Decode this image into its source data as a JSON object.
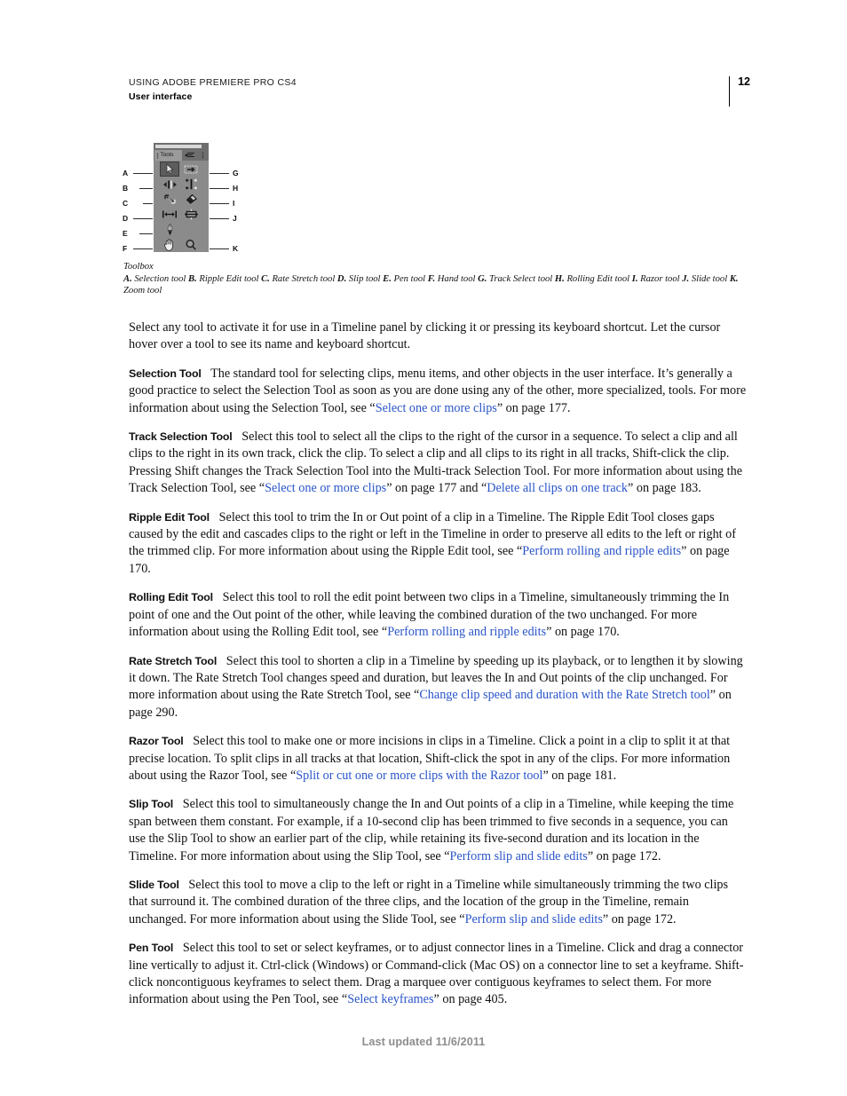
{
  "header": {
    "title": "USING ADOBE PREMIERE PRO CS4",
    "subtitle": "User interface",
    "page_number": "12"
  },
  "figure": {
    "panel": {
      "tab_label": "Tools",
      "menu_icon": "panel-menu-icon"
    },
    "tools": [
      {
        "letter": "A",
        "name": "Selection tool",
        "icon": "arrow-pointer-icon",
        "side": "left",
        "selected": true
      },
      {
        "letter": "B",
        "name": "Ripple Edit tool",
        "icon": "ripple-edit-icon",
        "side": "left",
        "selected": false
      },
      {
        "letter": "C",
        "name": "Rate Stretch tool",
        "icon": "rate-stretch-icon",
        "side": "left",
        "selected": false
      },
      {
        "letter": "D",
        "name": "Slip tool",
        "icon": "slip-tool-icon",
        "side": "left",
        "selected": false
      },
      {
        "letter": "E",
        "name": "Pen tool",
        "icon": "pen-tool-icon",
        "side": "left",
        "selected": false
      },
      {
        "letter": "F",
        "name": "Hand tool",
        "icon": "hand-tool-icon",
        "side": "left",
        "selected": false
      },
      {
        "letter": "G",
        "name": "Track Select tool",
        "icon": "track-select-icon",
        "side": "right",
        "selected": false
      },
      {
        "letter": "H",
        "name": "Rolling Edit tool",
        "icon": "rolling-edit-icon",
        "side": "right",
        "selected": false
      },
      {
        "letter": "I",
        "name": "Razor tool",
        "icon": "razor-blade-icon",
        "side": "right",
        "selected": false
      },
      {
        "letter": "J",
        "name": "Slide tool",
        "icon": "slide-tool-icon",
        "side": "right",
        "selected": false
      },
      {
        "letter": "K",
        "name": "Zoom tool",
        "icon": "magnifier-icon",
        "side": "right",
        "selected": false
      }
    ],
    "caption_title": "Toolbox",
    "caption_items": [
      {
        "letter": "A.",
        "text": "Selection tool"
      },
      {
        "letter": "B.",
        "text": "Ripple Edit tool"
      },
      {
        "letter": "C.",
        "text": "Rate Stretch tool"
      },
      {
        "letter": "D.",
        "text": "Slip tool"
      },
      {
        "letter": "E.",
        "text": "Pen tool"
      },
      {
        "letter": "F.",
        "text": "Hand tool"
      },
      {
        "letter": "G.",
        "text": "Track Select tool"
      },
      {
        "letter": "H.",
        "text": "Rolling Edit tool"
      },
      {
        "letter": "I.",
        "text": "Razor tool"
      },
      {
        "letter": "J.",
        "text": "Slide tool"
      },
      {
        "letter": "K.",
        "text": "Zoom tool"
      }
    ]
  },
  "body": {
    "intro": "Select any tool to activate it for use in a Timeline panel by clicking it or pressing its keyboard shortcut. Let the cursor hover over a tool to see its name and keyboard shortcut.",
    "sections": [
      {
        "heading": "Selection Tool",
        "parts": [
          {
            "type": "text",
            "value": "The standard tool for selecting clips, menu items, and other objects in the user interface. It’s generally a good practice to select the Selection Tool as soon as you are done using any of the other, more specialized, tools. For more information about using the Selection Tool, see “"
          },
          {
            "type": "link",
            "value": "Select one or more clips"
          },
          {
            "type": "text",
            "value": "” on page 177."
          }
        ]
      },
      {
        "heading": "Track Selection Tool",
        "parts": [
          {
            "type": "text",
            "value": "Select this tool to select all the clips to the right of the cursor in a sequence. To select a clip and all clips to the right in its own track, click the clip. To select a clip and all clips to its right in all tracks, Shift-click the clip. Pressing Shift changes the Track Selection Tool into the Multi-track Selection Tool. For more information about using the Track Selection Tool, see “"
          },
          {
            "type": "link",
            "value": "Select one or more clips"
          },
          {
            "type": "text",
            "value": "” on page 177 and “"
          },
          {
            "type": "link",
            "value": "Delete all clips on one track"
          },
          {
            "type": "text",
            "value": "” on page 183."
          }
        ]
      },
      {
        "heading": "Ripple Edit Tool",
        "parts": [
          {
            "type": "text",
            "value": "Select this tool to trim the In or Out point of a clip in a Timeline. The Ripple Edit Tool closes gaps caused by the edit and cascades clips to the right or left in the Timeline in order to preserve all edits to the left or right of the trimmed clip. For more information about using the Ripple Edit tool, see “"
          },
          {
            "type": "link",
            "value": "Perform rolling and ripple edits"
          },
          {
            "type": "text",
            "value": "” on page 170."
          }
        ]
      },
      {
        "heading": "Rolling Edit Tool",
        "parts": [
          {
            "type": "text",
            "value": "Select this tool to roll the edit point between two clips in a Timeline, simultaneously trimming the In point of one and the Out point of the other, while leaving the combined duration of the two unchanged. For more information about using the Rolling Edit tool, see “"
          },
          {
            "type": "link",
            "value": "Perform rolling and ripple edits"
          },
          {
            "type": "text",
            "value": "” on page 170."
          }
        ]
      },
      {
        "heading": "Rate Stretch Tool",
        "parts": [
          {
            "type": "text",
            "value": "Select this tool to shorten a clip in a Timeline by speeding up its playback, or to lengthen it by slowing it down. The Rate Stretch Tool changes speed and duration, but leaves the In and Out points of the clip unchanged. For more information about using the Rate Stretch Tool, see “"
          },
          {
            "type": "link",
            "value": "Change clip speed and duration with the Rate Stretch tool"
          },
          {
            "type": "text",
            "value": "” on page 290."
          }
        ]
      },
      {
        "heading": "Razor Tool",
        "parts": [
          {
            "type": "text",
            "value": "Select this tool to make one or more incisions in clips in a Timeline. Click a point in a clip to split it at that precise location. To split clips in all tracks at that location, Shift-click the spot in any of the clips. For more information about using the Razor Tool, see “"
          },
          {
            "type": "link",
            "value": "Split or cut one or more clips with the Razor tool"
          },
          {
            "type": "text",
            "value": "” on page 181."
          }
        ]
      },
      {
        "heading": "Slip Tool",
        "parts": [
          {
            "type": "text",
            "value": "Select this tool to simultaneously change the In and Out points of a clip in a Timeline, while keeping the time span between them constant. For example, if a 10-second clip has been trimmed to five seconds in a sequence, you can use the Slip Tool to show an earlier part of the clip, while retaining its five-second duration and its location in the Timeline. For more information about using the Slip Tool, see “"
          },
          {
            "type": "link",
            "value": "Perform slip and slide edits"
          },
          {
            "type": "text",
            "value": "” on page 172."
          }
        ]
      },
      {
        "heading": "Slide Tool",
        "parts": [
          {
            "type": "text",
            "value": "Select this tool to move a clip to the left or right in a Timeline while simultaneously trimming the two clips that surround it. The combined duration of the three clips, and the location of the group in the Timeline, remain unchanged. For more information about using the Slide Tool, see “"
          },
          {
            "type": "link",
            "value": "Perform slip and slide edits"
          },
          {
            "type": "text",
            "value": "” on page 172."
          }
        ]
      },
      {
        "heading": "Pen Tool",
        "parts": [
          {
            "type": "text",
            "value": "Select this tool to set or select keyframes, or to adjust connector lines in a Timeline. Click and drag a connector line vertically to adjust it. Ctrl-click (Windows) or Command-click (Mac OS) on a connector line to set a keyframe. Shift-click noncontiguous keyframes to select them. Drag a marquee over contiguous keyframes to select them. For more information about using the Pen Tool, see “"
          },
          {
            "type": "link",
            "value": "Select keyframes"
          },
          {
            "type": "text",
            "value": "” on page 405."
          }
        ]
      }
    ]
  },
  "footer": {
    "text": "Last updated 11/6/2011"
  },
  "colors": {
    "link": "#2a55c9",
    "panel_bg": "#8b8b8b",
    "panel_chrome": "#6e6e6e",
    "footer_text": "#8d8d8d"
  }
}
